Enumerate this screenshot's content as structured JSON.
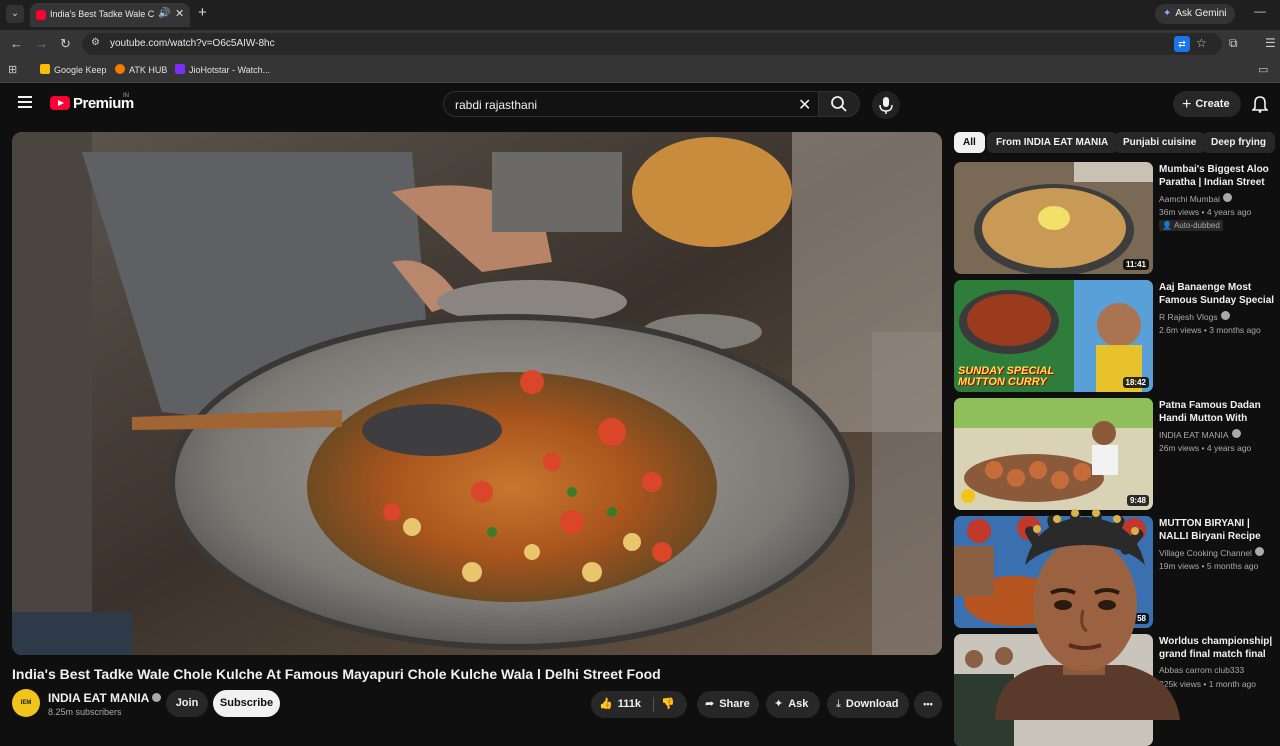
{
  "browser": {
    "tab_title": "India's Best Tadke Wale Chole Kulche",
    "new_tab": "+",
    "ask_gemini": "Ask Gemini",
    "url": "youtube.com/watch?v=O6c5AIW-8hc",
    "bookmarks": [
      {
        "label": "Google Keep",
        "color": "#fbbc04"
      },
      {
        "label": "ATK HUB",
        "color": "#f57c00"
      },
      {
        "label": "JioHotstar - Watch...",
        "color": "#7b2ff7"
      }
    ]
  },
  "header": {
    "brand": "Premium",
    "region": "IN",
    "search_query": "rabdi rajasthani",
    "create_label": "Create"
  },
  "video": {
    "title": "India's Best Tadke Wale Chole Kulche At Famous Mayapuri Chole Kulche Wala l Delhi Street Food",
    "channel": "INDIA EAT MANIA",
    "subscribers": "8.25m subscribers",
    "join_label": "Join",
    "subscribe_label": "Subscribe",
    "likes": "111k",
    "share_label": "Share",
    "ask_label": "Ask",
    "download_label": "Download",
    "more_label": "•••"
  },
  "chips": [
    "All",
    "From INDIA EAT MANIA",
    "Punjabi cuisine",
    "Deep frying"
  ],
  "recommendations": [
    {
      "title": "Mumbai's Biggest Aloo Paratha | Indian Street Food",
      "channel": "Aamchi Mumbai",
      "meta": "36m views • 4 years ago",
      "duration": "11:41",
      "badge": "Auto-dubbed"
    },
    {
      "title": "Aaj Banaenge Most Famous Sunday Special Mutton Curry",
      "channel": "R Rajesh Vlogs",
      "meta": "2.6m views • 3 months ago",
      "duration": "18:42",
      "thumb_text": "SUNDAY SPECIAL MUTTON CURRY"
    },
    {
      "title": "Patna Famous Dadan Handi Mutton With Unlimited Roti",
      "channel": "INDIA EAT MANIA",
      "meta": "26m views • 4 years ago",
      "duration": "9:48"
    },
    {
      "title": "MUTTON BIRYANI | NALLI Biryani Recipe Cooking in ...",
      "channel": "Village Cooking Channel",
      "meta": "19m views • 5 months ago",
      "duration": "58"
    },
    {
      "title": "Worldus championship| grand final match final frame us",
      "channel": "Abbas carrom club333",
      "meta": "325k views • 1 month ago",
      "duration": ""
    }
  ],
  "colors": {
    "accent": "#ff0033",
    "background": "#0f0f0f",
    "chip": "#272727"
  }
}
